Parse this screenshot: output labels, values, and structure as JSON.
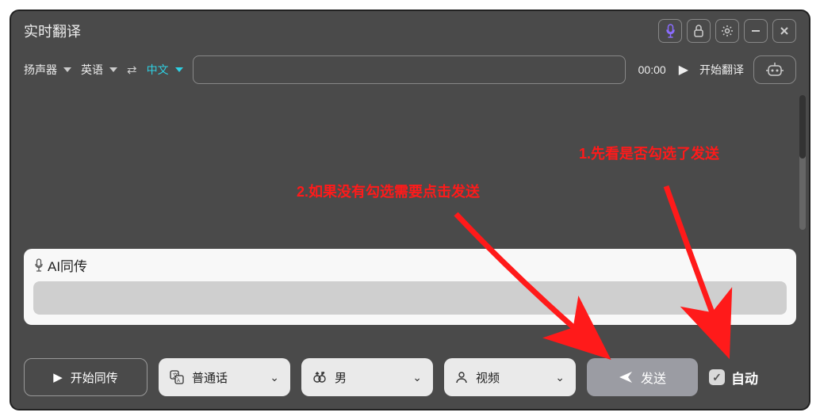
{
  "window": {
    "title": "实时翻译"
  },
  "toolbar": {
    "source_device": "扬声器",
    "source_lang": "英语",
    "target_lang": "中文",
    "input_value": "",
    "timer": "00:00",
    "start_translate": "开始翻译"
  },
  "annotations": {
    "step1": "1.先看是否勾选了发送",
    "step2": "2.如果没有勾选需要点击发送"
  },
  "ai_box": {
    "title": "AI同传"
  },
  "bottom": {
    "start_sync": "开始同传",
    "lang_select": "普通话",
    "gender_select": "男",
    "mode_select": "视频",
    "send": "发送",
    "auto": "自动",
    "auto_checked": true
  }
}
